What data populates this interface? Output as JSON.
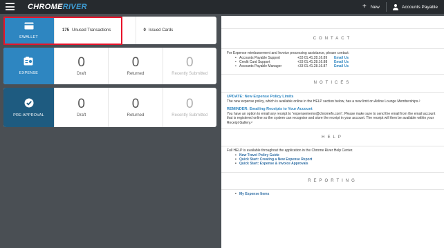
{
  "topbar": {
    "logo_part1": "CHROME",
    "logo_part2": "RIVER",
    "new_label": "New",
    "account_label": "Accounts Payable"
  },
  "ewallet": {
    "label": "EWALLET",
    "unused_count": "175",
    "unused_label": "Unused Transactions",
    "issued_count": "0",
    "issued_label": "Issued Cards"
  },
  "expense": {
    "label": "EXPENSE",
    "stats": [
      {
        "value": "0",
        "label": "Draft"
      },
      {
        "value": "0",
        "label": "Returned"
      },
      {
        "value": "0",
        "label": "Recently Submitted"
      }
    ]
  },
  "preapproval": {
    "label": "PRE-APPROVAL",
    "stats": [
      {
        "value": "0",
        "label": "Draft"
      },
      {
        "value": "0",
        "label": "Returned"
      },
      {
        "value": "0",
        "label": "Recently Submitted"
      }
    ]
  },
  "panel": {
    "contact": {
      "title": "CONTACT",
      "intro": "For Expense reimbursement and Invoice processing assistance, please contact:",
      "rows": [
        {
          "name": "Accounts Payable Support",
          "phone": "+33 01.41.28.16.89",
          "link": "Email Us"
        },
        {
          "name": "Credit Card Support",
          "phone": "+33 01.41.28.16.88",
          "link": "Email Us"
        },
        {
          "name": "Accounts Payable Manager",
          "phone": "+33 01.41.28.16.87",
          "link": "Email Us"
        }
      ]
    },
    "notices": {
      "title": "NOTICES",
      "item1_head": "UPDATE: New Expense Policy Limits",
      "item1_text": "The new expense policy, which is available online in the HELP section below, has a new limit on Airline Lounge Memberships.²",
      "item2_head": "REMINDER: Emailing Receipts to Your Account",
      "item2_text": "You have an option to email any receipt to “expensememo@chromefn.com”. Please make sure to send the email from the email account that is registered online so the system can recognise and store the receipt in your account. The receipt will then be available within your Receipt Gallery.²"
    },
    "help": {
      "title": "HELP",
      "intro": "Full HELP is available throughout the application in the Chrome River Help Center.",
      "links": [
        "New Travel Policy Guide",
        "Quick Start: Creating a New Expense Report",
        "Quick Start: Expense & Invoice Approvals"
      ]
    },
    "reporting": {
      "title": "REPORTING",
      "links": [
        "My Expense Items"
      ]
    }
  }
}
